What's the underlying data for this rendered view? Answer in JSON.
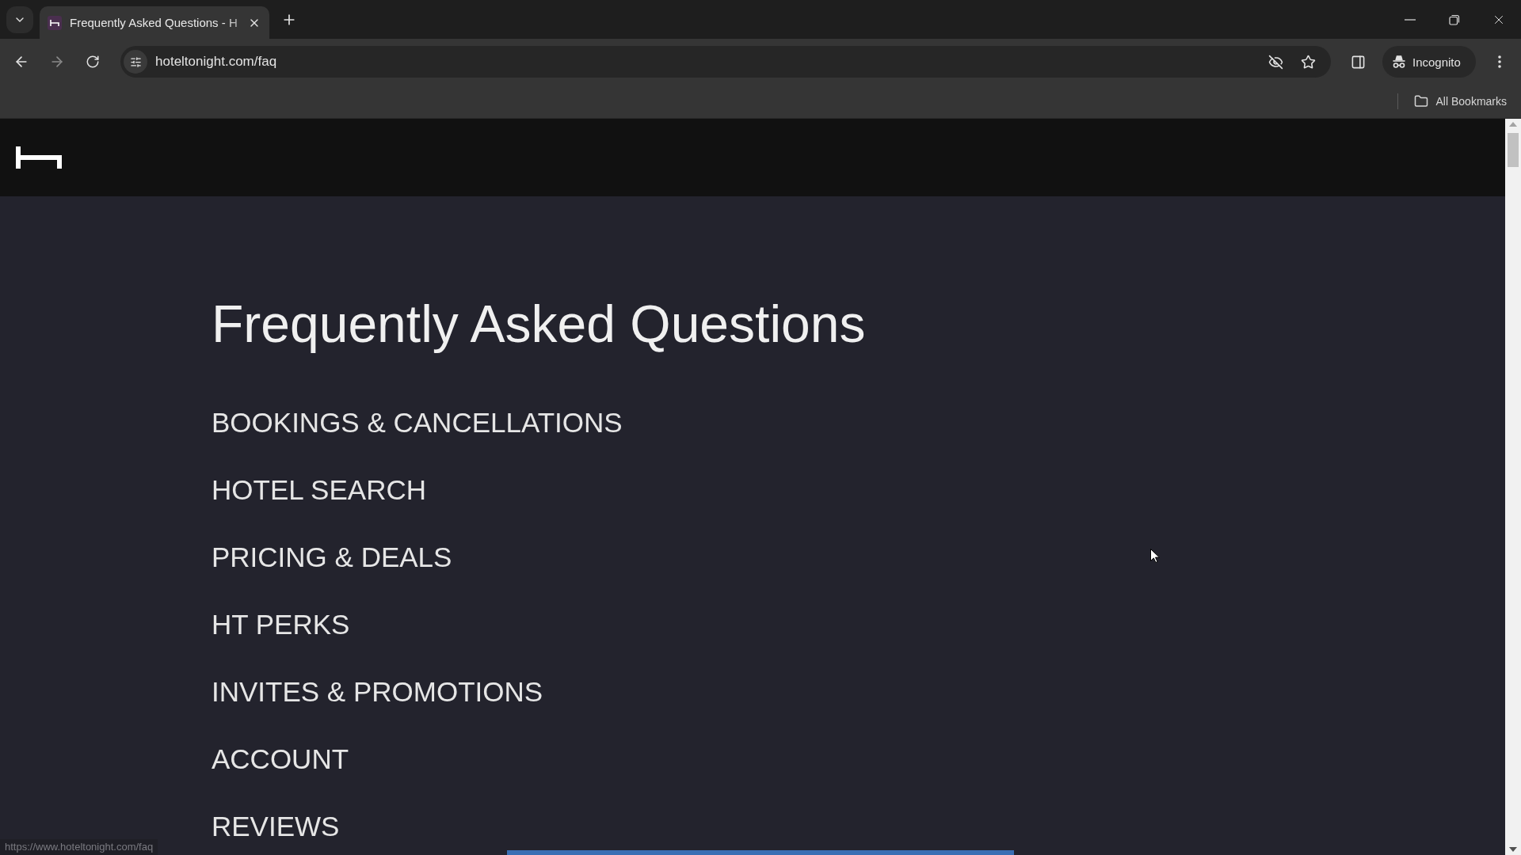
{
  "browser": {
    "tabs": [
      {
        "title": "Frequently Asked Questions - H",
        "selected": true
      }
    ],
    "address": "hoteltonight.com/faq",
    "profile_label": "Incognito",
    "bookmarks_label": "All Bookmarks"
  },
  "page": {
    "title": "Frequently Asked Questions",
    "categories": [
      "BOOKINGS & CANCELLATIONS",
      "HOTEL SEARCH",
      "PRICING & DEALS",
      "HT PERKS",
      "INVITES & PROMOTIONS",
      "ACCOUNT",
      "REVIEWS"
    ]
  },
  "status_bar": {
    "url": "https://www.hoteltonight.com/faq"
  }
}
